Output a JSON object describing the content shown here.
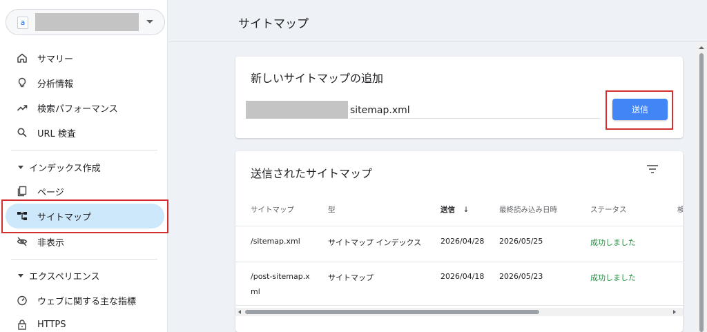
{
  "property": {
    "logo_letter": "a"
  },
  "sidebar": {
    "items": [
      {
        "label": "サマリー"
      },
      {
        "label": "分析情報"
      },
      {
        "label": "検索パフォーマンス"
      },
      {
        "label": "URL 検査"
      }
    ],
    "section_index": {
      "label": "インデックス作成"
    },
    "index_items": [
      {
        "label": "ページ"
      },
      {
        "label": "サイトマップ"
      },
      {
        "label": "非表示"
      }
    ],
    "section_experience": {
      "label": "エクスペリエンス"
    },
    "experience_items": [
      {
        "label": "ウェブに関する主な指標"
      },
      {
        "label": "HTTPS"
      }
    ]
  },
  "header": {
    "title": "サイトマップ"
  },
  "add_card": {
    "title": "新しいサイトマップの追加",
    "input_value": "sitemap.xml",
    "submit_label": "送信"
  },
  "submitted_card": {
    "title": "送信されたサイトマップ",
    "columns": [
      "サイトマップ",
      "型",
      "送信",
      "最終読み込み日時",
      "ステータス",
      "検"
    ],
    "sort_arrow": "↓",
    "rows": [
      {
        "sitemap": "/sitemap.xml",
        "type": "サイトマップ インデックス",
        "submitted": "2026/04/28",
        "last_read": "2026/05/25",
        "status": "成功しました"
      },
      {
        "sitemap_line1": "/post-sitemap.x",
        "sitemap_line2": "ml",
        "type": "サイトマップ",
        "submitted": "2026/04/18",
        "last_read": "2026/05/23",
        "status": "成功しました"
      }
    ]
  },
  "colors": {
    "accent": "#4285f4",
    "active_nav": "#cde7fb",
    "success": "#1e8e3e",
    "highlight": "#d32f2f"
  }
}
